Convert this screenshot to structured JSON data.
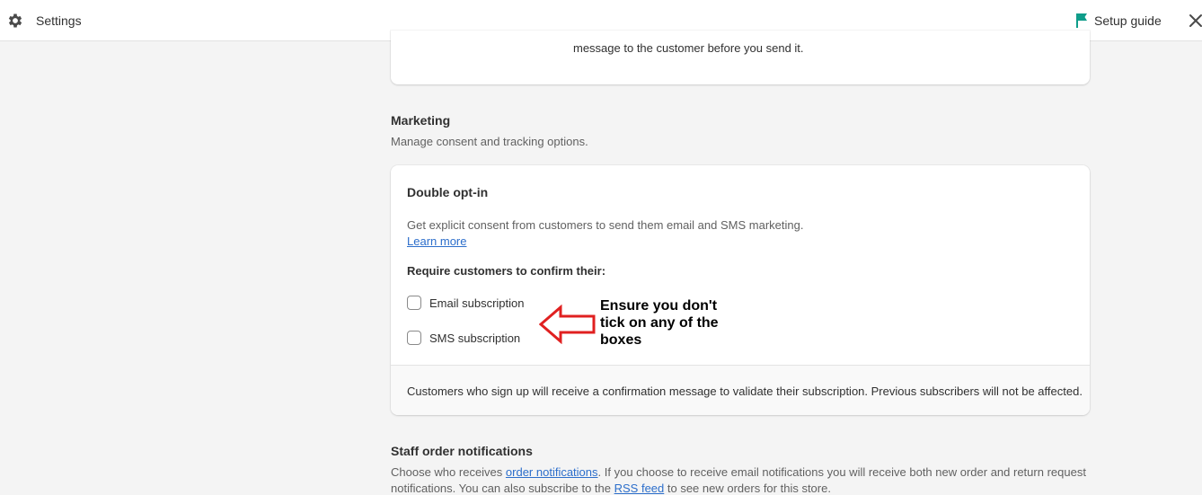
{
  "topbar": {
    "title": "Settings",
    "setup_guide": "Setup guide",
    "icons": {
      "settings": "gear-icon",
      "setup": "flag-icon",
      "close": "close-icon"
    },
    "flag_color": "#0f9d8a"
  },
  "top_card": {
    "text": "message to the customer before you send it."
  },
  "marketing": {
    "title": "Marketing",
    "subtitle": "Manage consent and tracking options."
  },
  "double_opt_in": {
    "title": "Double opt-in",
    "description": "Get explicit consent from customers to send them email and SMS marketing.",
    "learn_more": "Learn more",
    "require_label": "Require customers to confirm their:",
    "options": [
      {
        "label": "Email subscription",
        "checked": false
      },
      {
        "label": "SMS subscription",
        "checked": false
      }
    ],
    "footer": "Customers who sign up will receive a confirmation message to validate their subscription. Previous subscribers will not be affected."
  },
  "annotation": {
    "text": "Ensure you don't tick on any of the boxes",
    "arrow_color": "#e02020"
  },
  "staff": {
    "title": "Staff order notifications",
    "text_part1": "Choose who receives ",
    "link1": "order notifications",
    "text_part2": ". If you choose to receive email notifications you will receive both new order and return request notifications. You can also subscribe to the ",
    "link2": "RSS feed",
    "text_part3": " to see new orders for this store."
  }
}
